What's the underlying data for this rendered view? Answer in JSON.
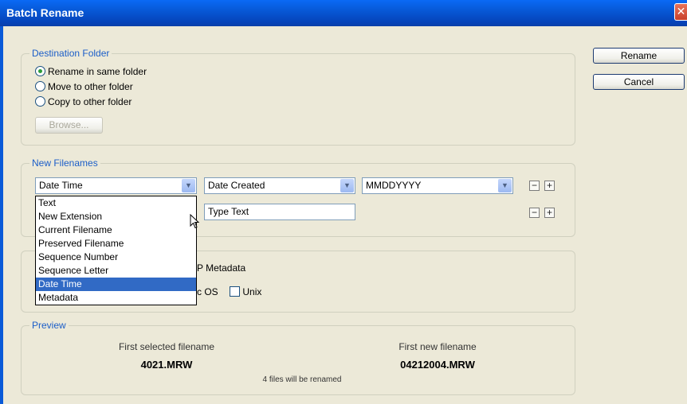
{
  "window": {
    "title": "Batch Rename",
    "close_glyph": "✕"
  },
  "buttons": {
    "rename": "Rename",
    "cancel": "Cancel"
  },
  "destination": {
    "legend": "Destination Folder",
    "options": [
      "Rename in same folder",
      "Move to other folder",
      "Copy to other folder"
    ],
    "selected_index": 0,
    "browse": "Browse..."
  },
  "new_filenames": {
    "legend": "New Filenames",
    "row1": {
      "field1": "Date Time",
      "field2": "Date Created",
      "field3": "MMDDYYYY"
    },
    "row2": {
      "text": "Type Text"
    },
    "minus": "−",
    "plus": "+"
  },
  "dropdown": {
    "items": [
      "Text",
      "New Extension",
      "Current Filename",
      "Preserved Filename",
      "Sequence Number",
      "Sequence Letter",
      "Date Time",
      "Metadata"
    ],
    "selected": "Date Time"
  },
  "options": {
    "xmp_label": "P Metadata",
    "compat_label": "c OS",
    "unix_label": "Unix"
  },
  "preview": {
    "legend": "Preview",
    "first_selected_label": "First selected filename",
    "first_selected_value": "4021.MRW",
    "first_new_label": "First new filename",
    "first_new_value": "04212004.MRW",
    "summary": "4 files will be renamed"
  },
  "icons": {
    "dropdown": "chevron-down-icon",
    "close": "close-icon",
    "cursor": "mouse-pointer-icon"
  }
}
